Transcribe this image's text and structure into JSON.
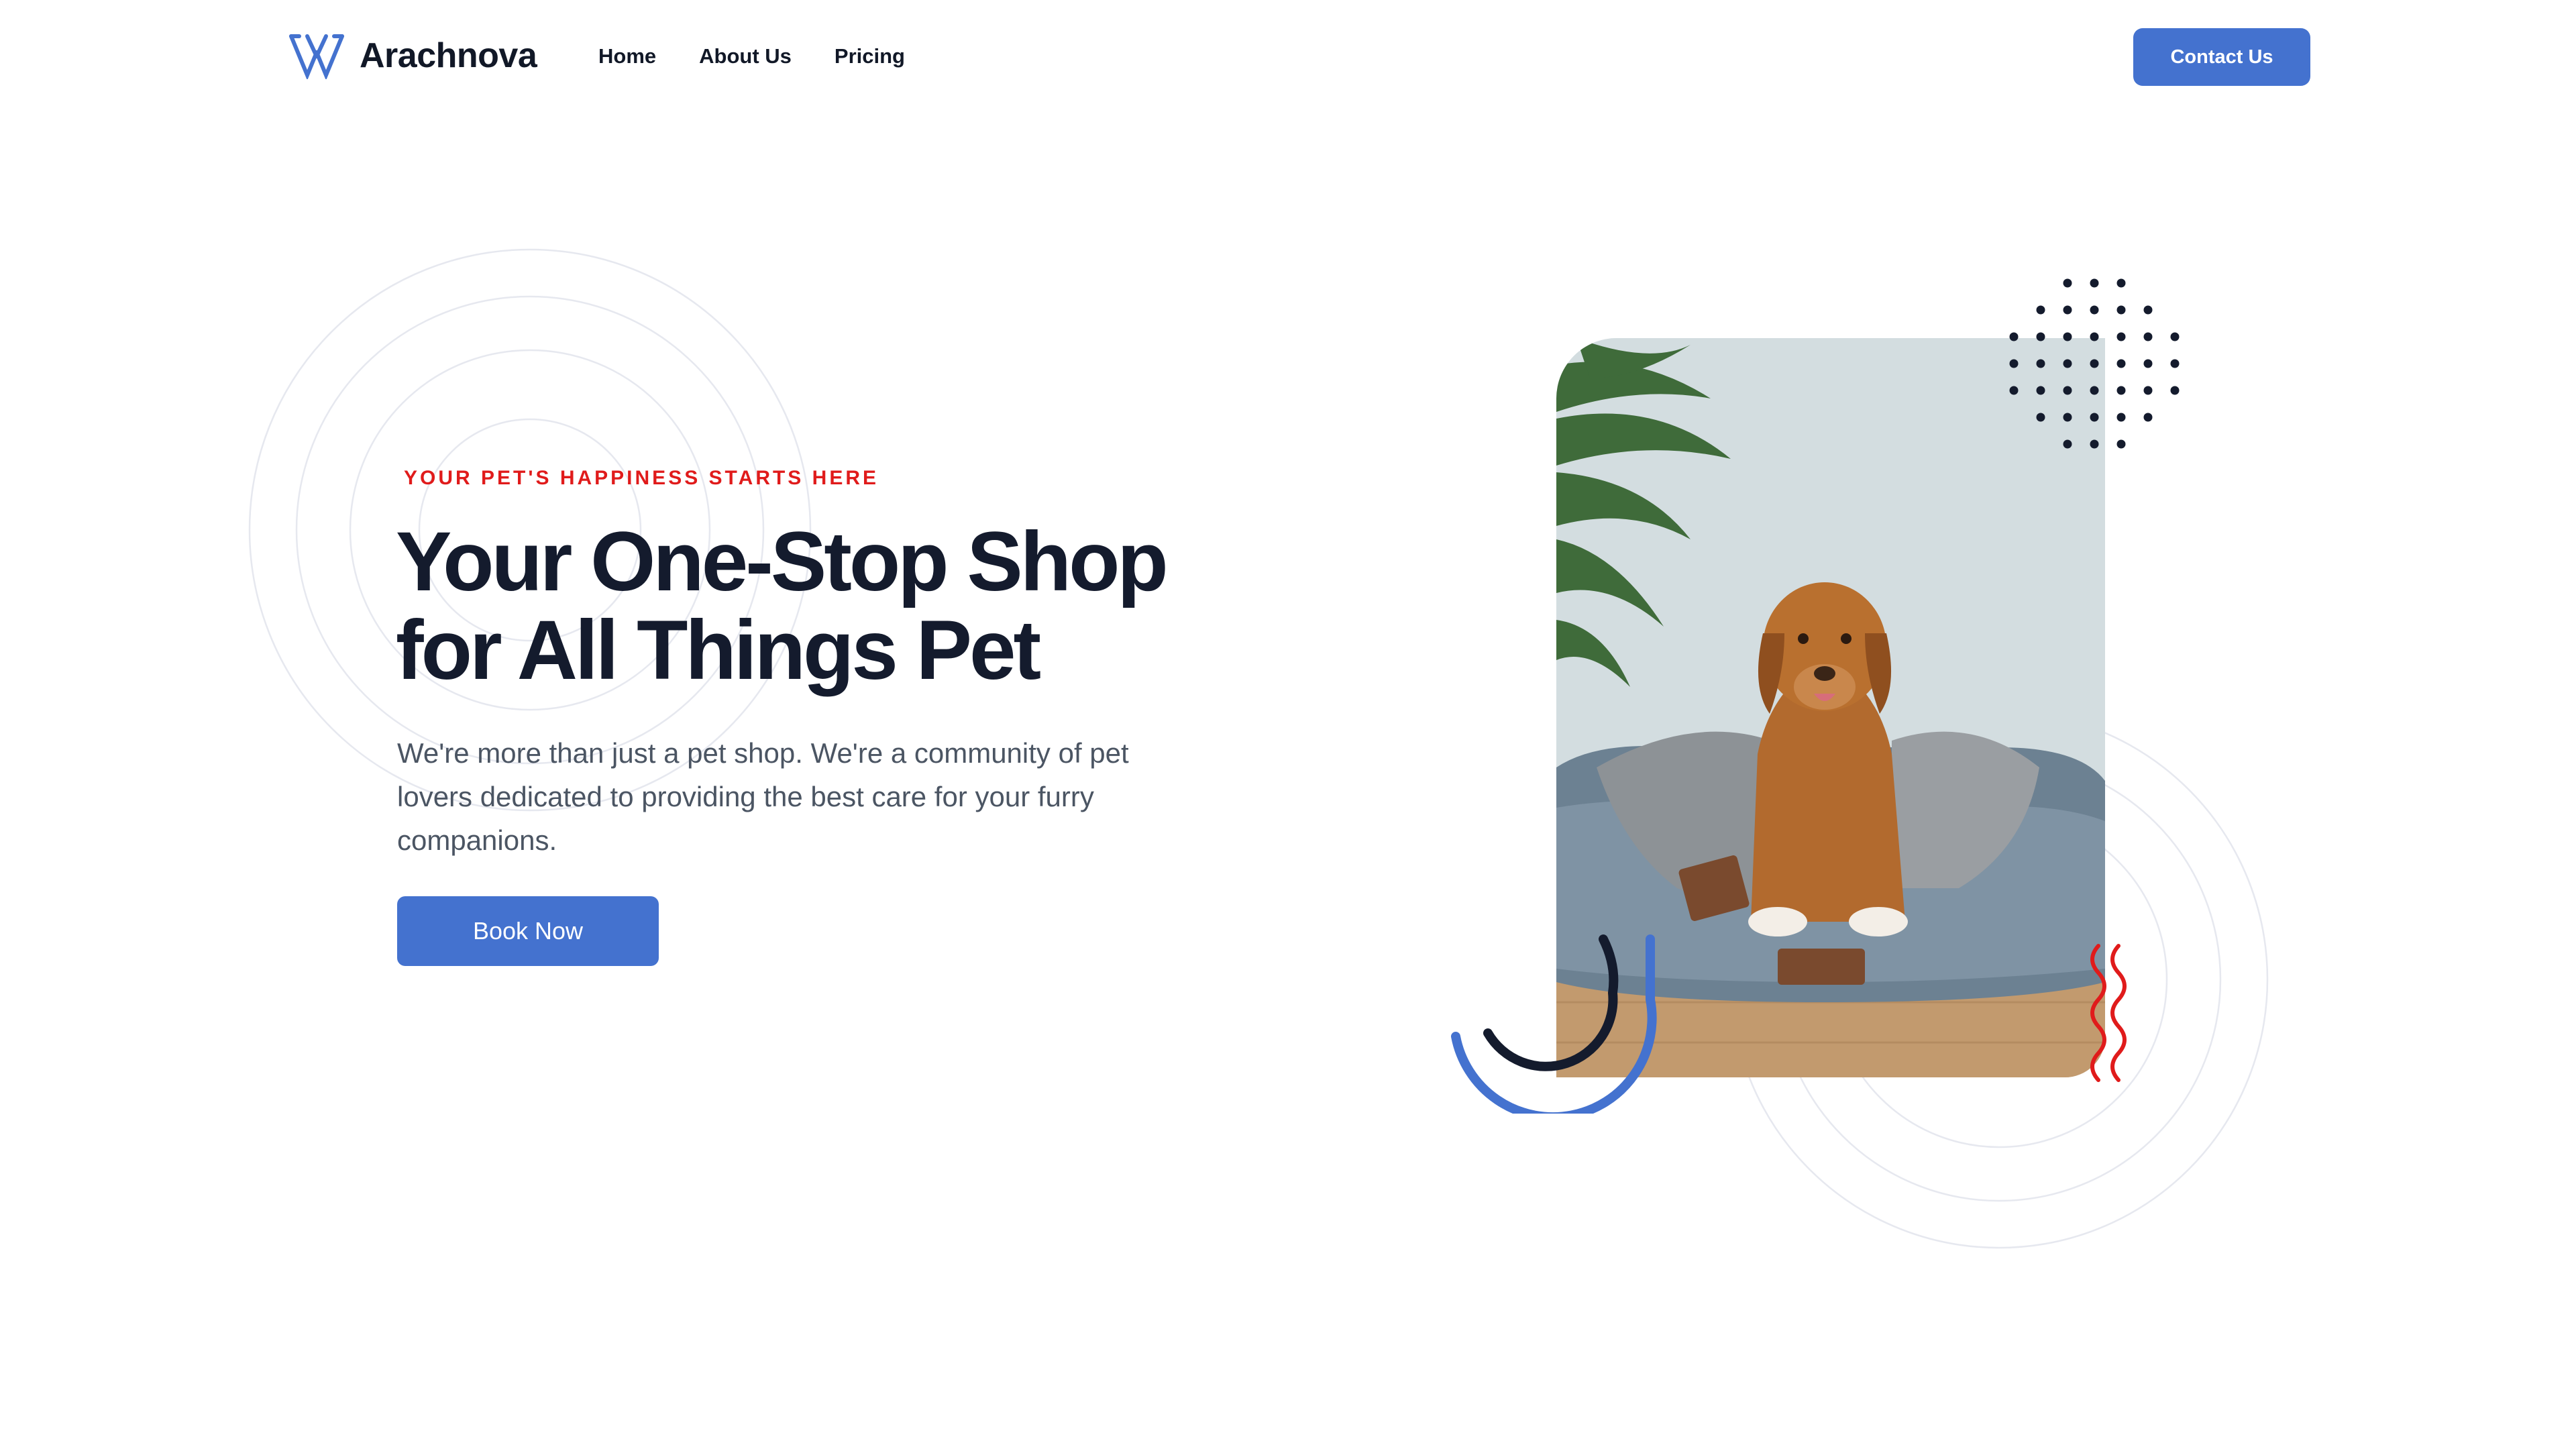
{
  "brand": {
    "name": "Arachnova",
    "logo_icon": "arachnova-logo-icon",
    "accent_color": "#4472cf"
  },
  "nav": {
    "links": [
      {
        "label": "Home"
      },
      {
        "label": "About Us"
      },
      {
        "label": "Pricing"
      }
    ],
    "cta_label": "Contact Us"
  },
  "hero": {
    "eyebrow": "YOUR PET'S HAPPINESS STARTS HERE",
    "eyebrow_color": "#e01b1b",
    "headline_line1": "Your One-Stop Shop",
    "headline_line2": "for All Things Pet",
    "subtext": "We're more than just a pet shop. We're a community of pet lovers dedicated to providing the best care for your furry companions.",
    "cta_label": "Book Now"
  },
  "image": {
    "subject": "dog-in-bed-photo"
  }
}
